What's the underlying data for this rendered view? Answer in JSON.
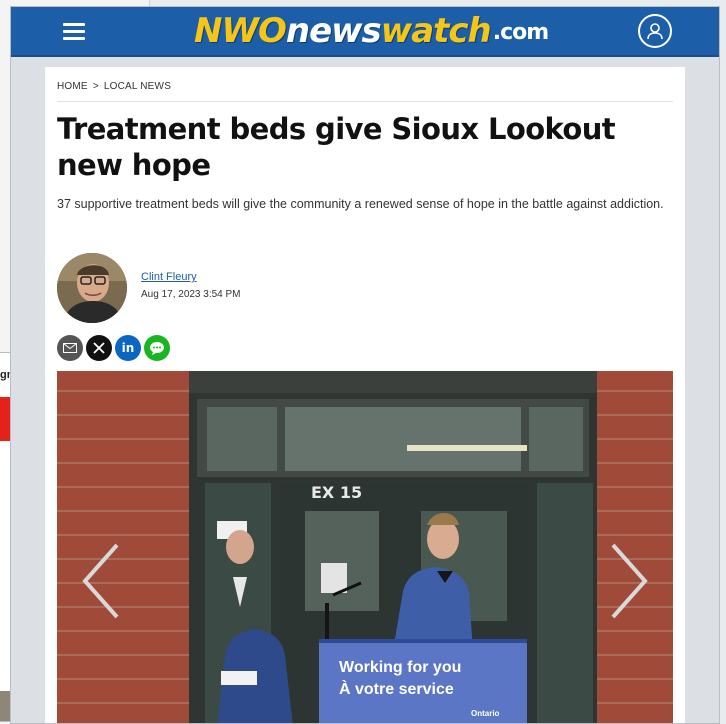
{
  "background": {
    "popup_sign_in": "gn In"
  },
  "header": {
    "logo_nwo": "NWO",
    "logo_news": "news",
    "logo_watch": "watch",
    "logo_tld": ".com",
    "menu_icon": "hamburger-menu-icon",
    "account_icon": "user-account-icon",
    "brand_color": "#1c5fa8"
  },
  "breadcrumb": {
    "home": "HOME",
    "separator": ">",
    "section": "LOCAL NEWS"
  },
  "article": {
    "headline": "Treatment beds give Sioux Lookout new hope",
    "subheadline": "37 supportive treatment beds will give the community a renewed sense of hope in the battle against addiction.",
    "author": "Clint Fleury",
    "date": "Aug 17, 2023 3:54 PM"
  },
  "share": {
    "icons": [
      "email-icon",
      "x-icon",
      "linkedin-icon",
      "messenger-icon"
    ],
    "linkedin_label": "in"
  },
  "photo": {
    "door_sign": "EX 15",
    "podium_line1": "Working for you",
    "podium_line2": "À votre service",
    "podium_brand": "Ontario",
    "prev_icon": "chevron-left-icon",
    "next_icon": "chevron-right-icon"
  }
}
